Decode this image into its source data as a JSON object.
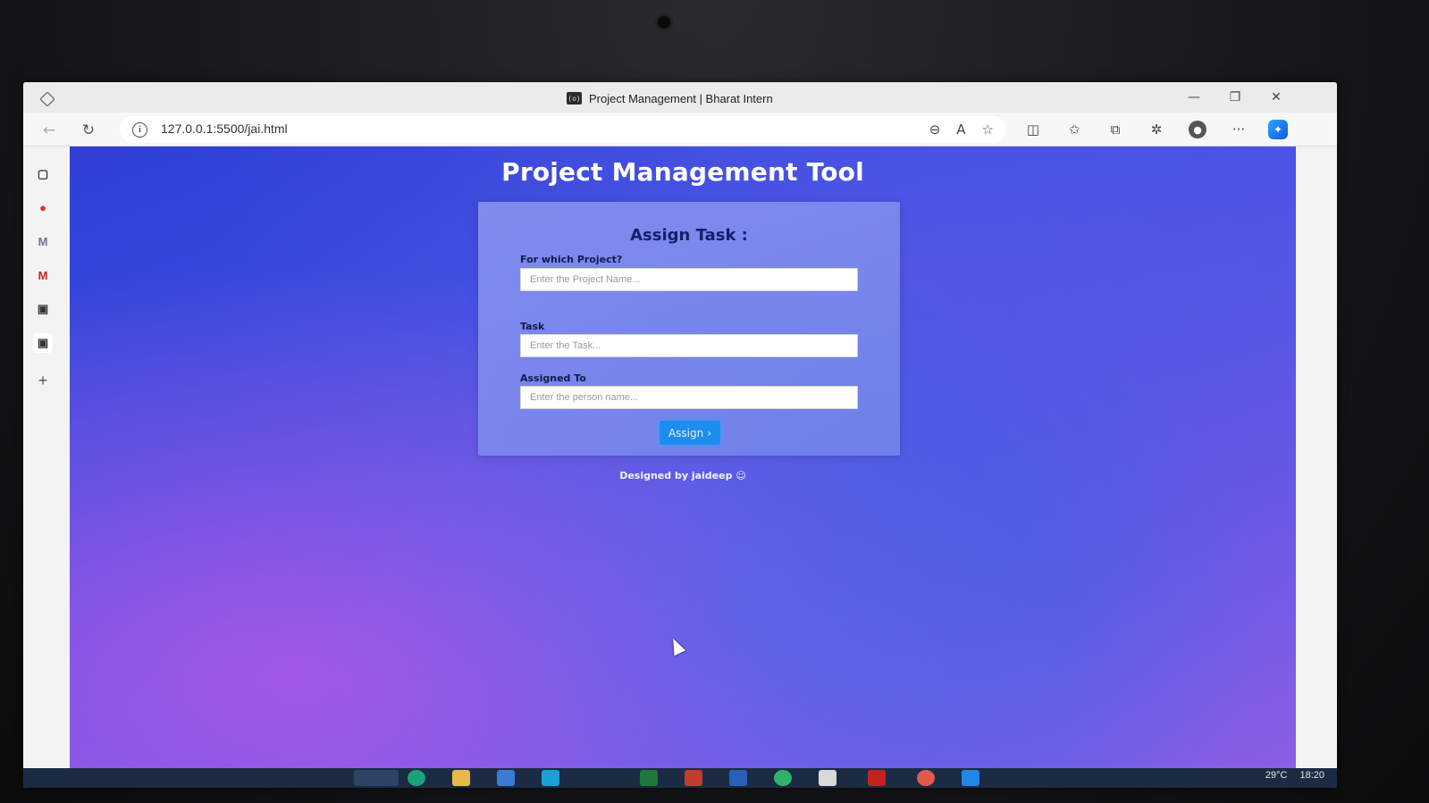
{
  "window": {
    "tab_title": "Project Management | Bharat Intern",
    "favicon_glyph": "(o)",
    "controls": {
      "minimize": "—",
      "restore": "❐",
      "close": "✕"
    }
  },
  "navbar": {
    "back_glyph": "←",
    "reload_glyph": "↻",
    "url": "127.0.0.1:5500/jai.html",
    "info_glyph": "i",
    "icons": {
      "zoom": "⊖",
      "read_aloud": "A",
      "favorite": "☆",
      "split_screen": "◫",
      "favorites_bar": "✩",
      "collections": "⧉",
      "extensions": "✲",
      "profile": "●",
      "more": "···",
      "copilot": "✦"
    }
  },
  "sidebar": {
    "items": [
      {
        "glyph": "▢",
        "color": "#333333"
      },
      {
        "glyph": "●",
        "color": "#d93025"
      },
      {
        "glyph": "M",
        "color": "#7b6c9a"
      },
      {
        "glyph": "M",
        "color": "#c5221f"
      },
      {
        "glyph": "▣",
        "color": "#333333"
      },
      {
        "glyph": "▣",
        "color": "#333333"
      },
      {
        "glyph": "+",
        "color": "#555555"
      }
    ]
  },
  "page": {
    "title": "Project Management Tool",
    "card": {
      "heading": "Assign Task :",
      "fields": [
        {
          "label": "For which Project?",
          "placeholder": "Enter the Project Name...",
          "value": ""
        },
        {
          "label": "Task",
          "placeholder": "Enter the Task...",
          "value": ""
        },
        {
          "label": "Assigned To",
          "placeholder": "Enter the person name...",
          "value": ""
        }
      ],
      "button_label": "Assign",
      "button_glyph": "›"
    },
    "footer": "Designed by jaideep",
    "footer_emoji": "☺"
  },
  "taskbar": {
    "weather": "29°C",
    "time": "18:20"
  },
  "colors": {
    "card_heading": "#14206a",
    "button": "#1f8cf0",
    "taskbar": "#1b2b44"
  }
}
